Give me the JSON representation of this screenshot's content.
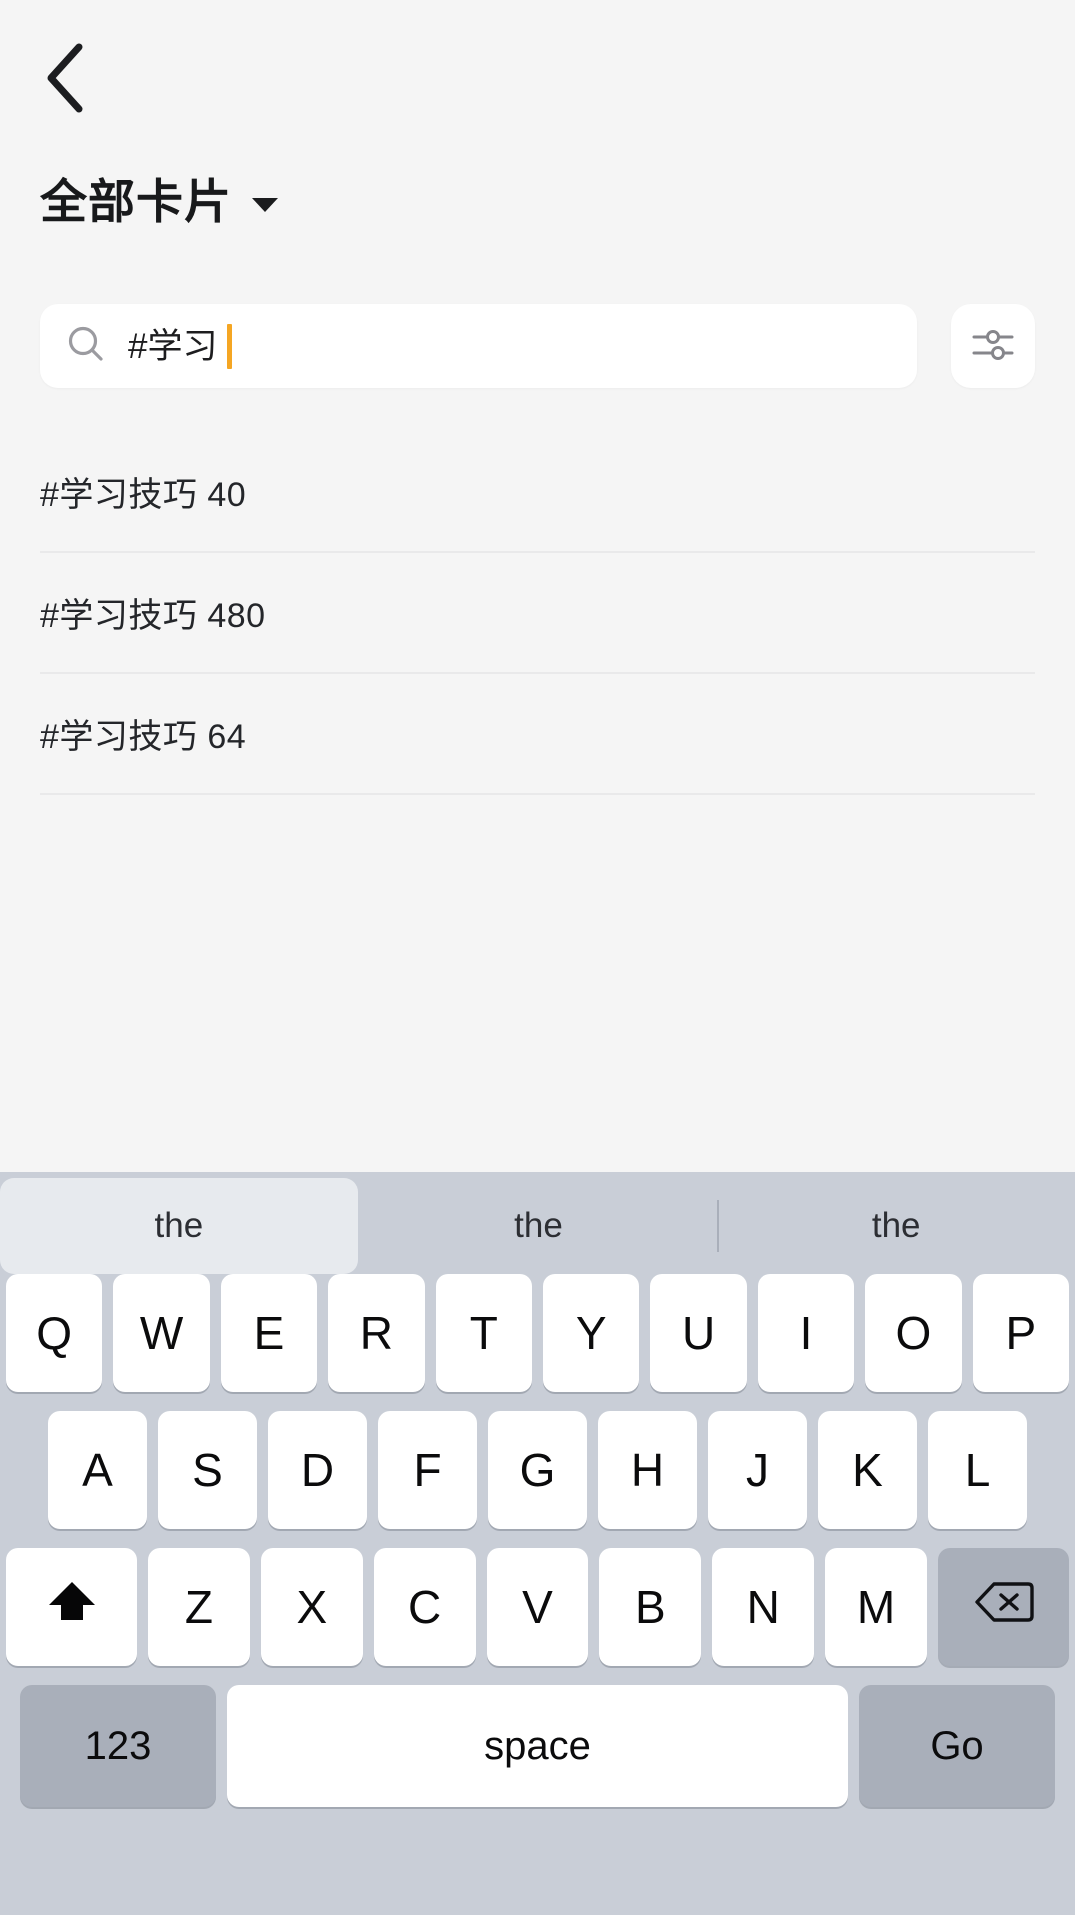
{
  "header": {
    "back_icon": "chevron-left-icon",
    "title": "全部卡片",
    "dropdown_icon": "caret-down-icon"
  },
  "search": {
    "icon": "search-icon",
    "value": "#学习",
    "placeholder": "",
    "cursor_color": "#f5a623",
    "filter_icon": "sliders-icon"
  },
  "suggestions": [
    {
      "label": "#学习技巧 40"
    },
    {
      "label": "#学习技巧 480"
    },
    {
      "label": "#学习技巧 64"
    }
  ],
  "keyboard": {
    "predictions": [
      {
        "label": "the",
        "active": true
      },
      {
        "label": "the",
        "active": false
      },
      {
        "label": "the",
        "active": false
      }
    ],
    "row1": [
      "Q",
      "W",
      "E",
      "R",
      "T",
      "Y",
      "U",
      "I",
      "O",
      "P"
    ],
    "row2": [
      "A",
      "S",
      "D",
      "F",
      "G",
      "H",
      "J",
      "K",
      "L"
    ],
    "row3_letters": [
      "Z",
      "X",
      "C",
      "V",
      "B",
      "N",
      "M"
    ],
    "shift_icon": "shift-arrow-icon",
    "backspace_icon": "backspace-icon",
    "numeric_label": "123",
    "space_label": "space",
    "go_label": "Go",
    "background_color": "#c9ced7",
    "key_color": "#ffffff",
    "function_key_color": "#a9afba"
  }
}
